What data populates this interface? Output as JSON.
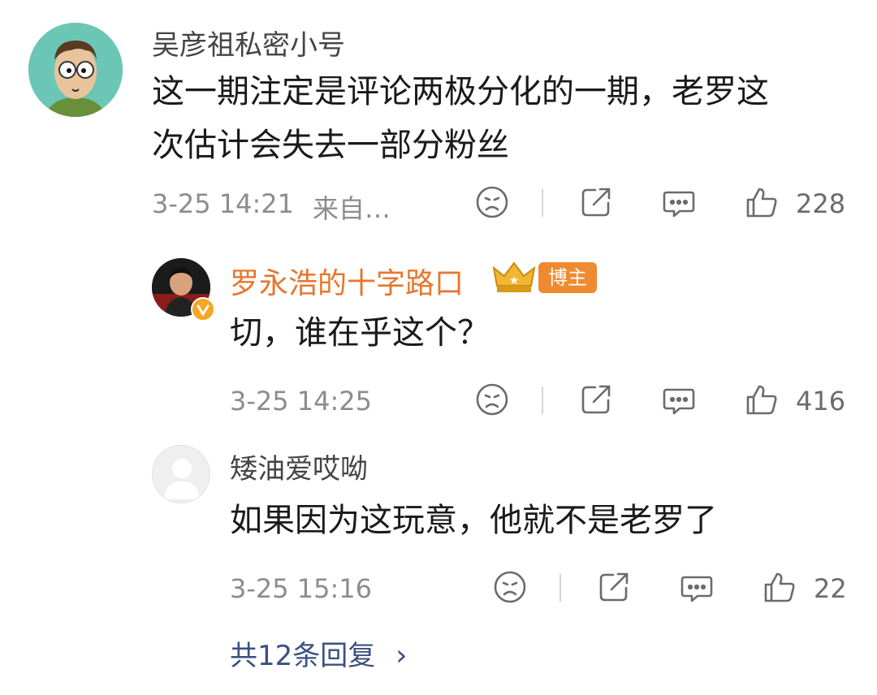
{
  "comments": [
    {
      "username": "吴彦祖私密小号",
      "text_line1": "这一期注定是评论两极分化的一期，老罗这",
      "text_line2": "次估计会失去一部分粉丝",
      "time": "3-25 14:21",
      "source": "来自…",
      "likes": "228"
    },
    {
      "username": "罗永浩的十字路口",
      "badge": "博主",
      "text": "切，谁在乎这个？",
      "time": "3-25 14:25",
      "likes": "416"
    },
    {
      "username": "矮油爱哎呦",
      "text": "如果因为这玩意，他就不是老罗了",
      "time": "3-25 15:16",
      "likes": "22"
    }
  ],
  "more_replies": {
    "label": "共12条回复",
    "arrow": "›"
  },
  "icons": [
    "sad-face-icon",
    "share-icon",
    "comment-icon",
    "thumbs-up-icon",
    "chevron-right-icon",
    "crown-icon",
    "verified-icon"
  ],
  "colors": {
    "blogger_name": "#e8762d",
    "badge": "#f08a30",
    "link": "#3b4f82",
    "verified": "#f5a623"
  }
}
